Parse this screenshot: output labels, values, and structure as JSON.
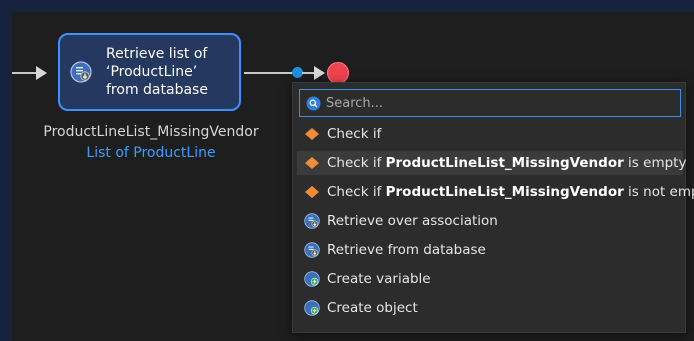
{
  "activity": {
    "line1": "Retrieve list of",
    "line2": "‘ProductLine’",
    "line3": "from database"
  },
  "caption": {
    "variable": "ProductLineList_MissingVendor",
    "type": "List of ProductLine"
  },
  "menu": {
    "search_placeholder": "Search...",
    "items": [
      {
        "prefix": "Check if",
        "bold": "",
        "suffix": "",
        "icon": "diamond-icon"
      },
      {
        "prefix": "Check if ",
        "bold": "ProductLineList_MissingVendor",
        "suffix": " is empty",
        "icon": "diamond-icon"
      },
      {
        "prefix": "Check if ",
        "bold": "ProductLineList_MissingVendor",
        "suffix": " is not empty",
        "icon": "diamond-icon"
      },
      {
        "prefix": "Retrieve over association",
        "bold": "",
        "suffix": "",
        "icon": "retrieve-icon"
      },
      {
        "prefix": "Retrieve from database",
        "bold": "",
        "suffix": "",
        "icon": "retrieve-icon"
      },
      {
        "prefix": "Create variable",
        "bold": "",
        "suffix": "",
        "icon": "create-icon"
      },
      {
        "prefix": "Create object",
        "bold": "",
        "suffix": "",
        "icon": "create-icon"
      }
    ]
  },
  "colors": {
    "accent": "#3f8fff",
    "end_event": "#f04350",
    "diamond": "#f28c38",
    "frame": "#17233d"
  }
}
